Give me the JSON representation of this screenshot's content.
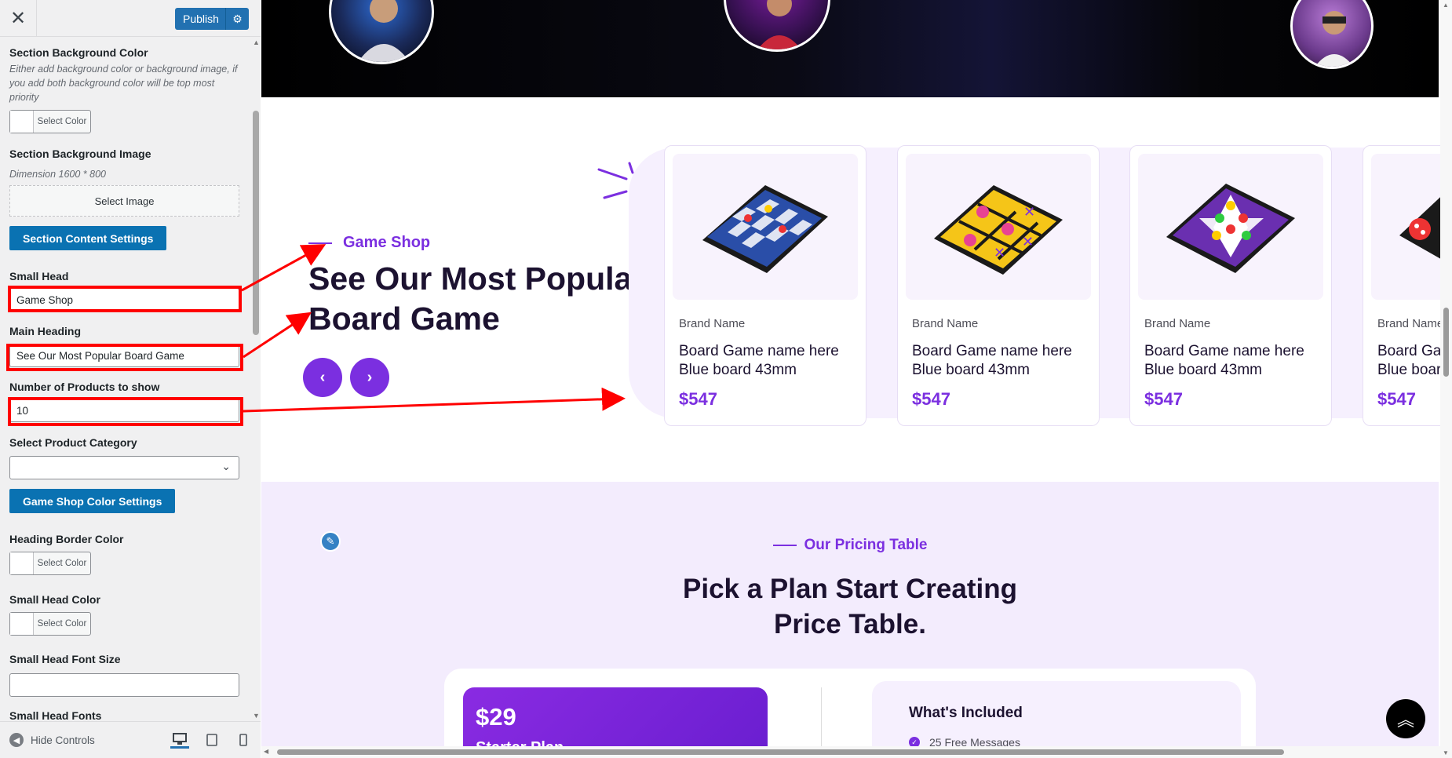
{
  "customizer": {
    "publish_label": "Publish",
    "hide_controls_label": "Hide Controls",
    "sections": {
      "bg_color_label": "Section Background Color",
      "bg_color_desc": "Either add background color or background image, if you add both background color will be top most priority",
      "select_color_label": "Select Color",
      "bg_image_label": "Section Background Image",
      "bg_image_desc": "Dimension 1600 * 800",
      "select_image_label": "Select Image",
      "content_settings_label": "Section Content Settings",
      "small_head_label": "Small Head",
      "small_head_value": "Game Shop",
      "main_heading_label": "Main Heading",
      "main_heading_value": "See Our Most Popular Board Game",
      "num_products_label": "Number of Products to show",
      "num_products_value": "10",
      "product_category_label": "Select Product Category",
      "color_settings_label": "Game Shop Color Settings",
      "heading_border_color_label": "Heading Border Color",
      "small_head_color_label": "Small Head Color",
      "small_head_font_size_label": "Small Head Font Size",
      "small_head_fonts_label": "Small Head Fonts"
    }
  },
  "preview": {
    "game_section": {
      "small_head": "Game Shop",
      "main_heading": "See Our Most Popular Board Game",
      "prev_icon": "chevron-left-icon",
      "next_icon": "chevron-right-icon",
      "products": [
        {
          "brand": "Brand Name",
          "name": "Board Game name here Blue board 43mm",
          "price": "$547",
          "image": "checkers-board"
        },
        {
          "brand": "Brand Name",
          "name": "Board Game name here Blue board 43mm",
          "price": "$547",
          "image": "tic-tac-toe-board"
        },
        {
          "brand": "Brand Name",
          "name": "Board Game name here Blue board 43mm",
          "price": "$547",
          "image": "chinese-checkers-board"
        },
        {
          "brand": "Brand Name",
          "name": "Board Ga",
          "name2": "Blue boar",
          "price": "$547",
          "image": "dice-board"
        }
      ]
    },
    "pricing": {
      "small_head": "Our Pricing Table",
      "heading_line1": "Pick a Plan Start Creating",
      "heading_line2": "Price Table.",
      "plan_price": "$29",
      "plan_name": "Starter Plan",
      "included_title": "What's Included",
      "feature_1": "25 Free Messages"
    }
  },
  "colors": {
    "accent": "#7b2fe0",
    "wp_blue": "#2271b1",
    "highlight_red": "#ff0000",
    "heading_dark": "#1c1230"
  }
}
